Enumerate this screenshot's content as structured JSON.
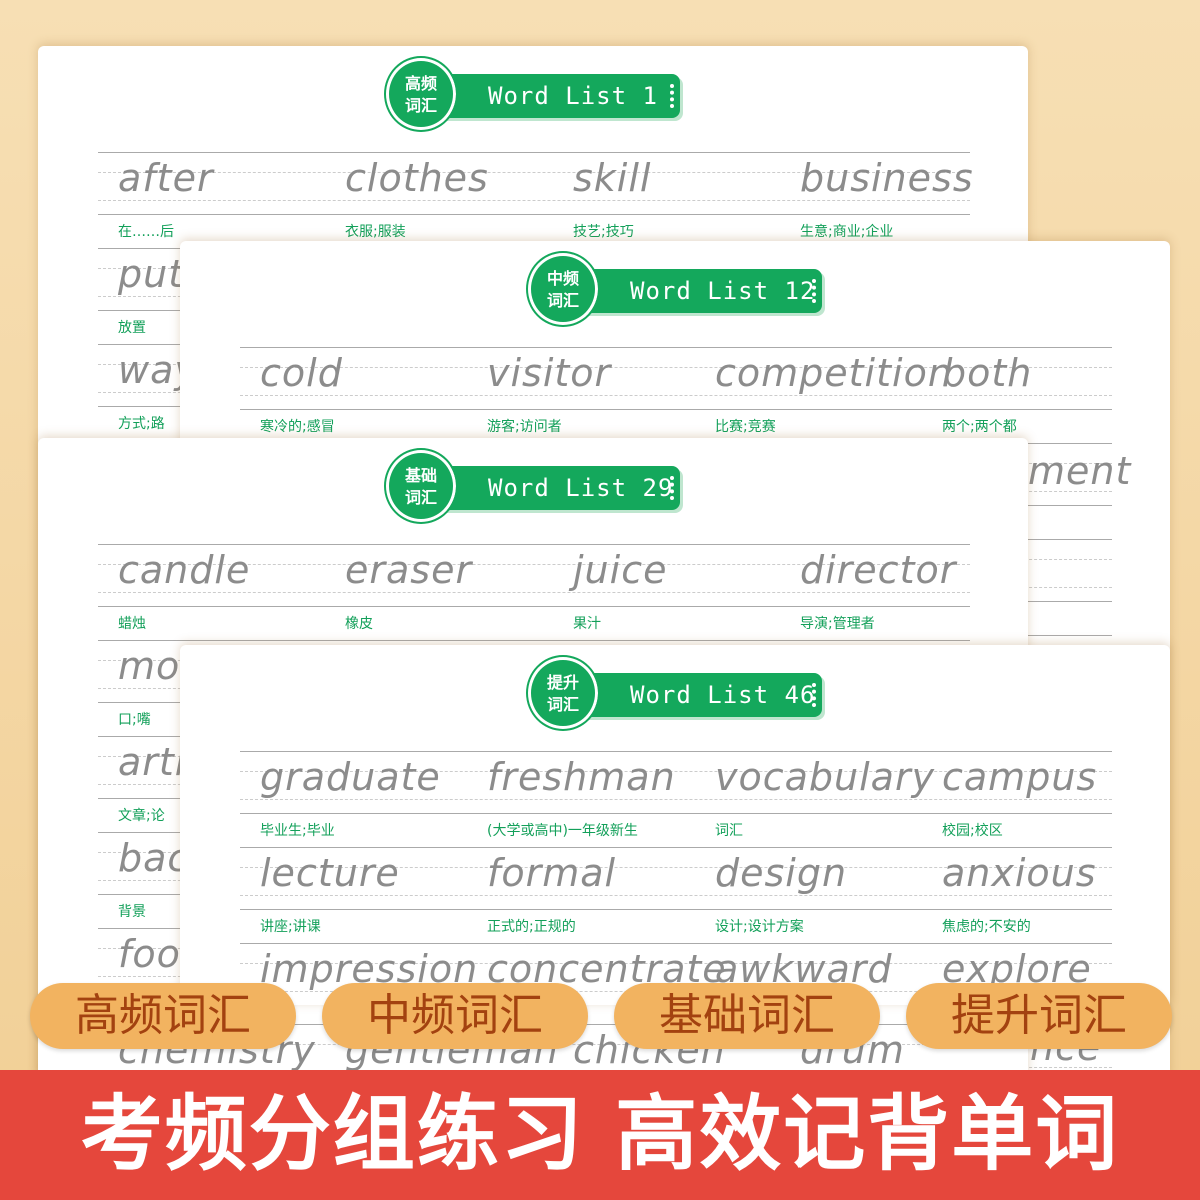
{
  "cards": [
    {
      "category": "高频\n词汇",
      "title": "Word List 1",
      "rows": [
        {
          "words": [
            "after",
            "clothes",
            "skill",
            "business"
          ],
          "meanings": [
            "在……后",
            "衣服;服装",
            "技艺;技巧",
            "生意;商业;企业"
          ]
        },
        {
          "words": [
            "put"
          ],
          "meanings": [
            "放置"
          ]
        },
        {
          "words": [
            "way"
          ],
          "meanings": [
            "方式;路"
          ]
        }
      ]
    },
    {
      "category": "中频\n词汇",
      "title": "Word List 12",
      "rows": [
        {
          "words": [
            "cold",
            "visitor",
            "competition",
            "both"
          ],
          "meanings": [
            "寒冷的;感冒",
            "游客;访问者",
            "比赛;竞赛",
            "两个;两个都"
          ]
        }
      ],
      "fragments": [
        "ment",
        "nce"
      ]
    },
    {
      "category": "基础\n词汇",
      "title": "Word List 29",
      "rows": [
        {
          "words": [
            "candle",
            "eraser",
            "juice",
            "director"
          ],
          "meanings": [
            "蜡烛",
            "橡皮",
            "果汁",
            "导演;管理者"
          ]
        },
        {
          "words": [
            "mou"
          ],
          "meanings": [
            "口;嘴"
          ]
        },
        {
          "words": [
            "arti"
          ],
          "meanings": [
            "文章;论"
          ]
        },
        {
          "words": [
            "bac"
          ],
          "meanings": [
            "背景"
          ]
        },
        {
          "words": [
            "foo"
          ],
          "meanings": []
        },
        {
          "words": [
            "chemistry",
            "gentleman",
            "chicken",
            "drum"
          ],
          "meanings": []
        }
      ]
    },
    {
      "category": "提升\n词汇",
      "title": "Word List 46",
      "rows": [
        {
          "words": [
            "graduate",
            "freshman",
            "vocabulary",
            "campus"
          ],
          "meanings": [
            "毕业生;毕业",
            "(大学或高中)一年级新生",
            "词汇",
            "校园;校区"
          ]
        },
        {
          "words": [
            "lecture",
            "formal",
            "design",
            "anxious"
          ],
          "meanings": [
            "讲座;讲课",
            "正式的;正规的",
            "设计;设计方案",
            "焦虑的;不安的"
          ]
        },
        {
          "words": [
            "impression",
            "concentrate",
            "awkward",
            "explore"
          ],
          "meanings": []
        }
      ]
    }
  ],
  "tags": [
    "高频词汇",
    "中频词汇",
    "基础词汇",
    "提升词汇"
  ],
  "banner": "考频分组练习 高效记背单词",
  "colors": {
    "green": "#14a85c",
    "orange": "#f2b360",
    "red": "#e5473c"
  }
}
